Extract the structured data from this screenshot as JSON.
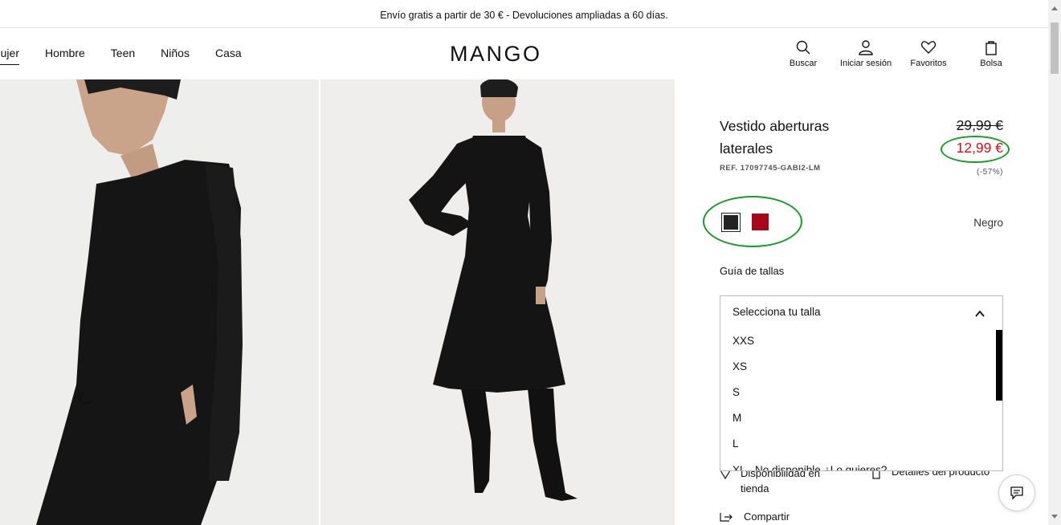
{
  "announcement": "Envío gratis a partir de 30 € - Devoluciones ampliadas a 60 días.",
  "nav": {
    "items": [
      "Mujer",
      "Hombre",
      "Teen",
      "Niños",
      "Casa"
    ]
  },
  "logo": "MANGO",
  "header_actions": [
    {
      "label": "Buscar",
      "icon": "search-icon"
    },
    {
      "label": "Iniciar sesión",
      "icon": "user-icon"
    },
    {
      "label": "Favoritos",
      "icon": "heart-icon"
    },
    {
      "label": "Bolsa",
      "icon": "bag-icon"
    }
  ],
  "product": {
    "title": "Vestido aberturas laterales",
    "ref": "REF. 17097745-GABI2-LM",
    "old_price": "29,99 €",
    "price": "12,99 €",
    "discount": "(-57%)",
    "selected_color": "Negro",
    "colors": [
      {
        "name": "Negro",
        "hex": "#222222"
      },
      {
        "name": "Rojo",
        "hex": "#a8071a"
      }
    ]
  },
  "size_guide": "Guía de tallas",
  "size_select": {
    "placeholder": "Selecciona tu talla",
    "options": [
      "XXS",
      "XS",
      "S",
      "M",
      "L"
    ],
    "partial_last": "XL - No disponible ¿Lo quieres?"
  },
  "below": {
    "availability": "Disponibilidad en tienda",
    "details": "Detalles del producto",
    "share": "Compartir"
  },
  "accent_colors": {
    "sale": "#d0121a",
    "annotation": "#1a9a2a"
  }
}
